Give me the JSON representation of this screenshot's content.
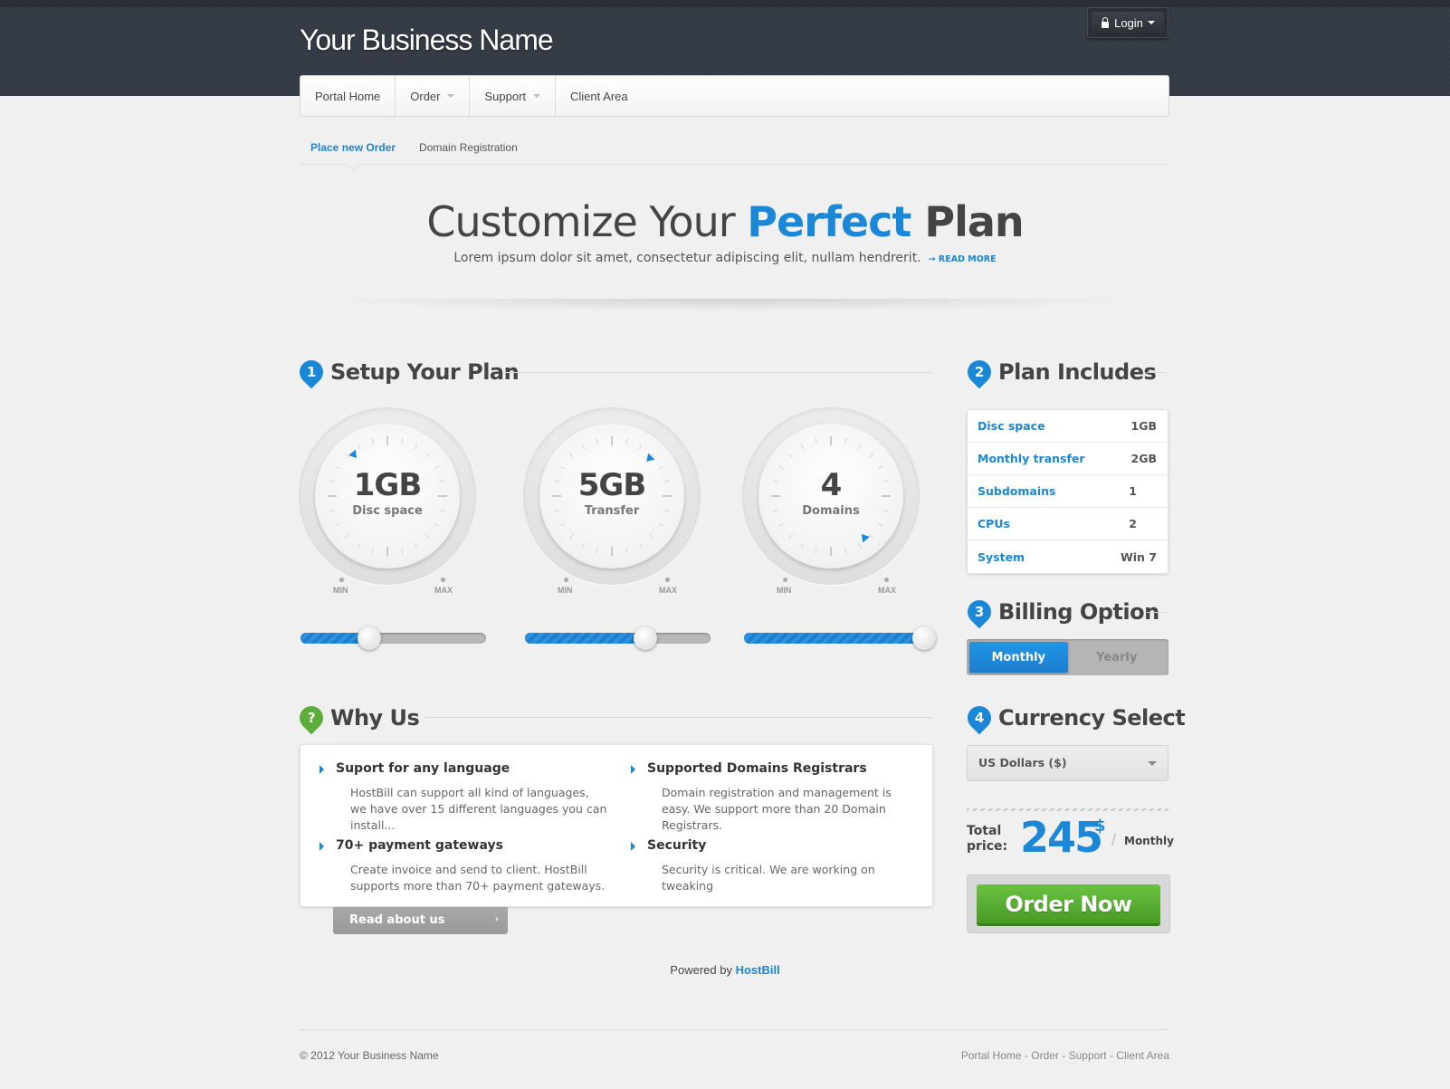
{
  "header": {
    "brand": "Your Business Name",
    "login_label": "Login"
  },
  "nav": [
    {
      "label": "Portal Home",
      "dropdown": false
    },
    {
      "label": "Order",
      "dropdown": true
    },
    {
      "label": "Support",
      "dropdown": true
    },
    {
      "label": "Client Area",
      "dropdown": false
    }
  ],
  "subnav": {
    "active": "Place new Order",
    "other": "Domain Registration"
  },
  "hero": {
    "title_part1": "Customize Your ",
    "title_highlight": "Perfect",
    "title_part2": " Plan",
    "subtitle": "Lorem ipsum dolor sit amet, consectetur adipiscing elit, nullam hendrerit.",
    "read_more": "READ MORE"
  },
  "setup": {
    "number": "1",
    "title": "Setup Your Plan",
    "min_label": "MIN",
    "max_label": "MAX",
    "dials": [
      {
        "value": "1GB",
        "label": "Disc space",
        "level": 0.37
      },
      {
        "value": "5GB",
        "label": "Transfer",
        "level": 0.65
      },
      {
        "value": "4",
        "label": "Domains",
        "level": 0.97
      }
    ]
  },
  "why": {
    "number": "?",
    "title": "Why Us",
    "items": [
      {
        "title": "Suport for any language",
        "text": "HostBill can support all kind of languages, we have over 15 different languages you can install..."
      },
      {
        "title": "Supported Domains Registrars",
        "text": "Domain registration and management is easy. We support more than 20 Domain Registrars."
      },
      {
        "title": "70+ payment gateways",
        "text": "Create invoice and send to client. HostBill supports more than 70+ payment gateways."
      },
      {
        "title": "Security",
        "text": "Security is critical. We are working on tweaking"
      }
    ],
    "read_button": "Read about us"
  },
  "includes": {
    "number": "2",
    "title": "Plan Includes",
    "rows": [
      {
        "key": "Disc space",
        "value": "1GB"
      },
      {
        "key": "Monthly transfer",
        "value": "2GB"
      },
      {
        "key": "Subdomains",
        "value": "1"
      },
      {
        "key": "CPUs",
        "value": "2"
      },
      {
        "key": "System",
        "value": "Win 7"
      }
    ]
  },
  "billing": {
    "number": "3",
    "title": "Billing Option",
    "monthly": "Monthly",
    "yearly": "Yearly",
    "selected": "Monthly"
  },
  "currency": {
    "number": "4",
    "title": "Currency Select",
    "selected": "US Dollars ($)"
  },
  "total": {
    "label_line1": "Total",
    "label_line2": "price:",
    "amount": "245",
    "symbol": "$",
    "period": "Monthly"
  },
  "order_button": "Order Now",
  "footer": {
    "powered_by": "Powered by",
    "powered_link": "HostBill",
    "copyright": "© 2012 Your Business Name",
    "links": [
      "Portal Home",
      "Order",
      "Support",
      "Client Area"
    ]
  },
  "colors": {
    "accent": "#1a87d7",
    "order_green": "#5cad3a",
    "header_bg": "#363c46"
  }
}
